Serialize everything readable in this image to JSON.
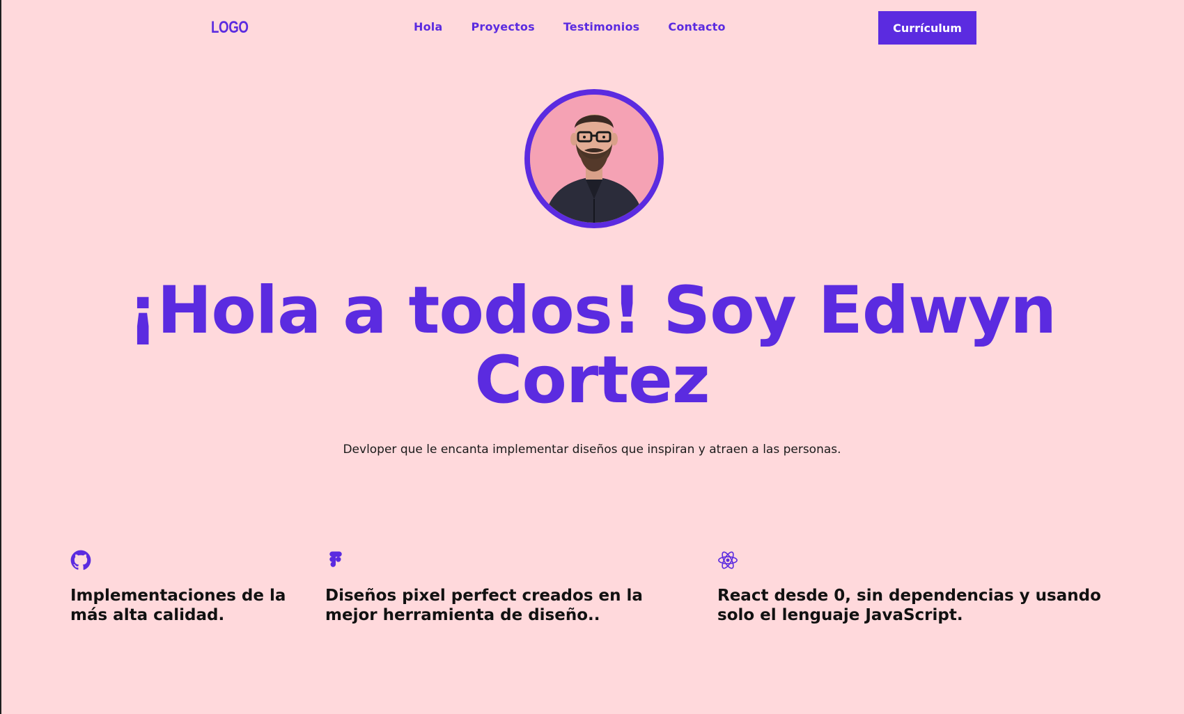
{
  "header": {
    "logo": "LOGO",
    "nav": [
      "Hola",
      "Proyectos",
      "Testimonios",
      "Contacto"
    ],
    "cv_button": "Currículum"
  },
  "hero": {
    "avatar_alt": "avatar",
    "title": "¡Hola a todos! Soy Edwyn Cortez",
    "subtitle": "Devloper que le encanta implementar diseños que inspiran y atraen a las personas."
  },
  "features": [
    {
      "icon": "github-icon",
      "text": "Implementaciones de la más alta calidad."
    },
    {
      "icon": "figma-icon",
      "text": "Diseños pixel perfect creados en la mejor herramienta de diseño.."
    },
    {
      "icon": "react-icon",
      "text": "React desde 0, sin dependencias y usando solo el lenguaje JavaScript."
    }
  ],
  "colors": {
    "background": "#ffd9dc",
    "accent": "#5b2be0",
    "text": "#111111"
  }
}
